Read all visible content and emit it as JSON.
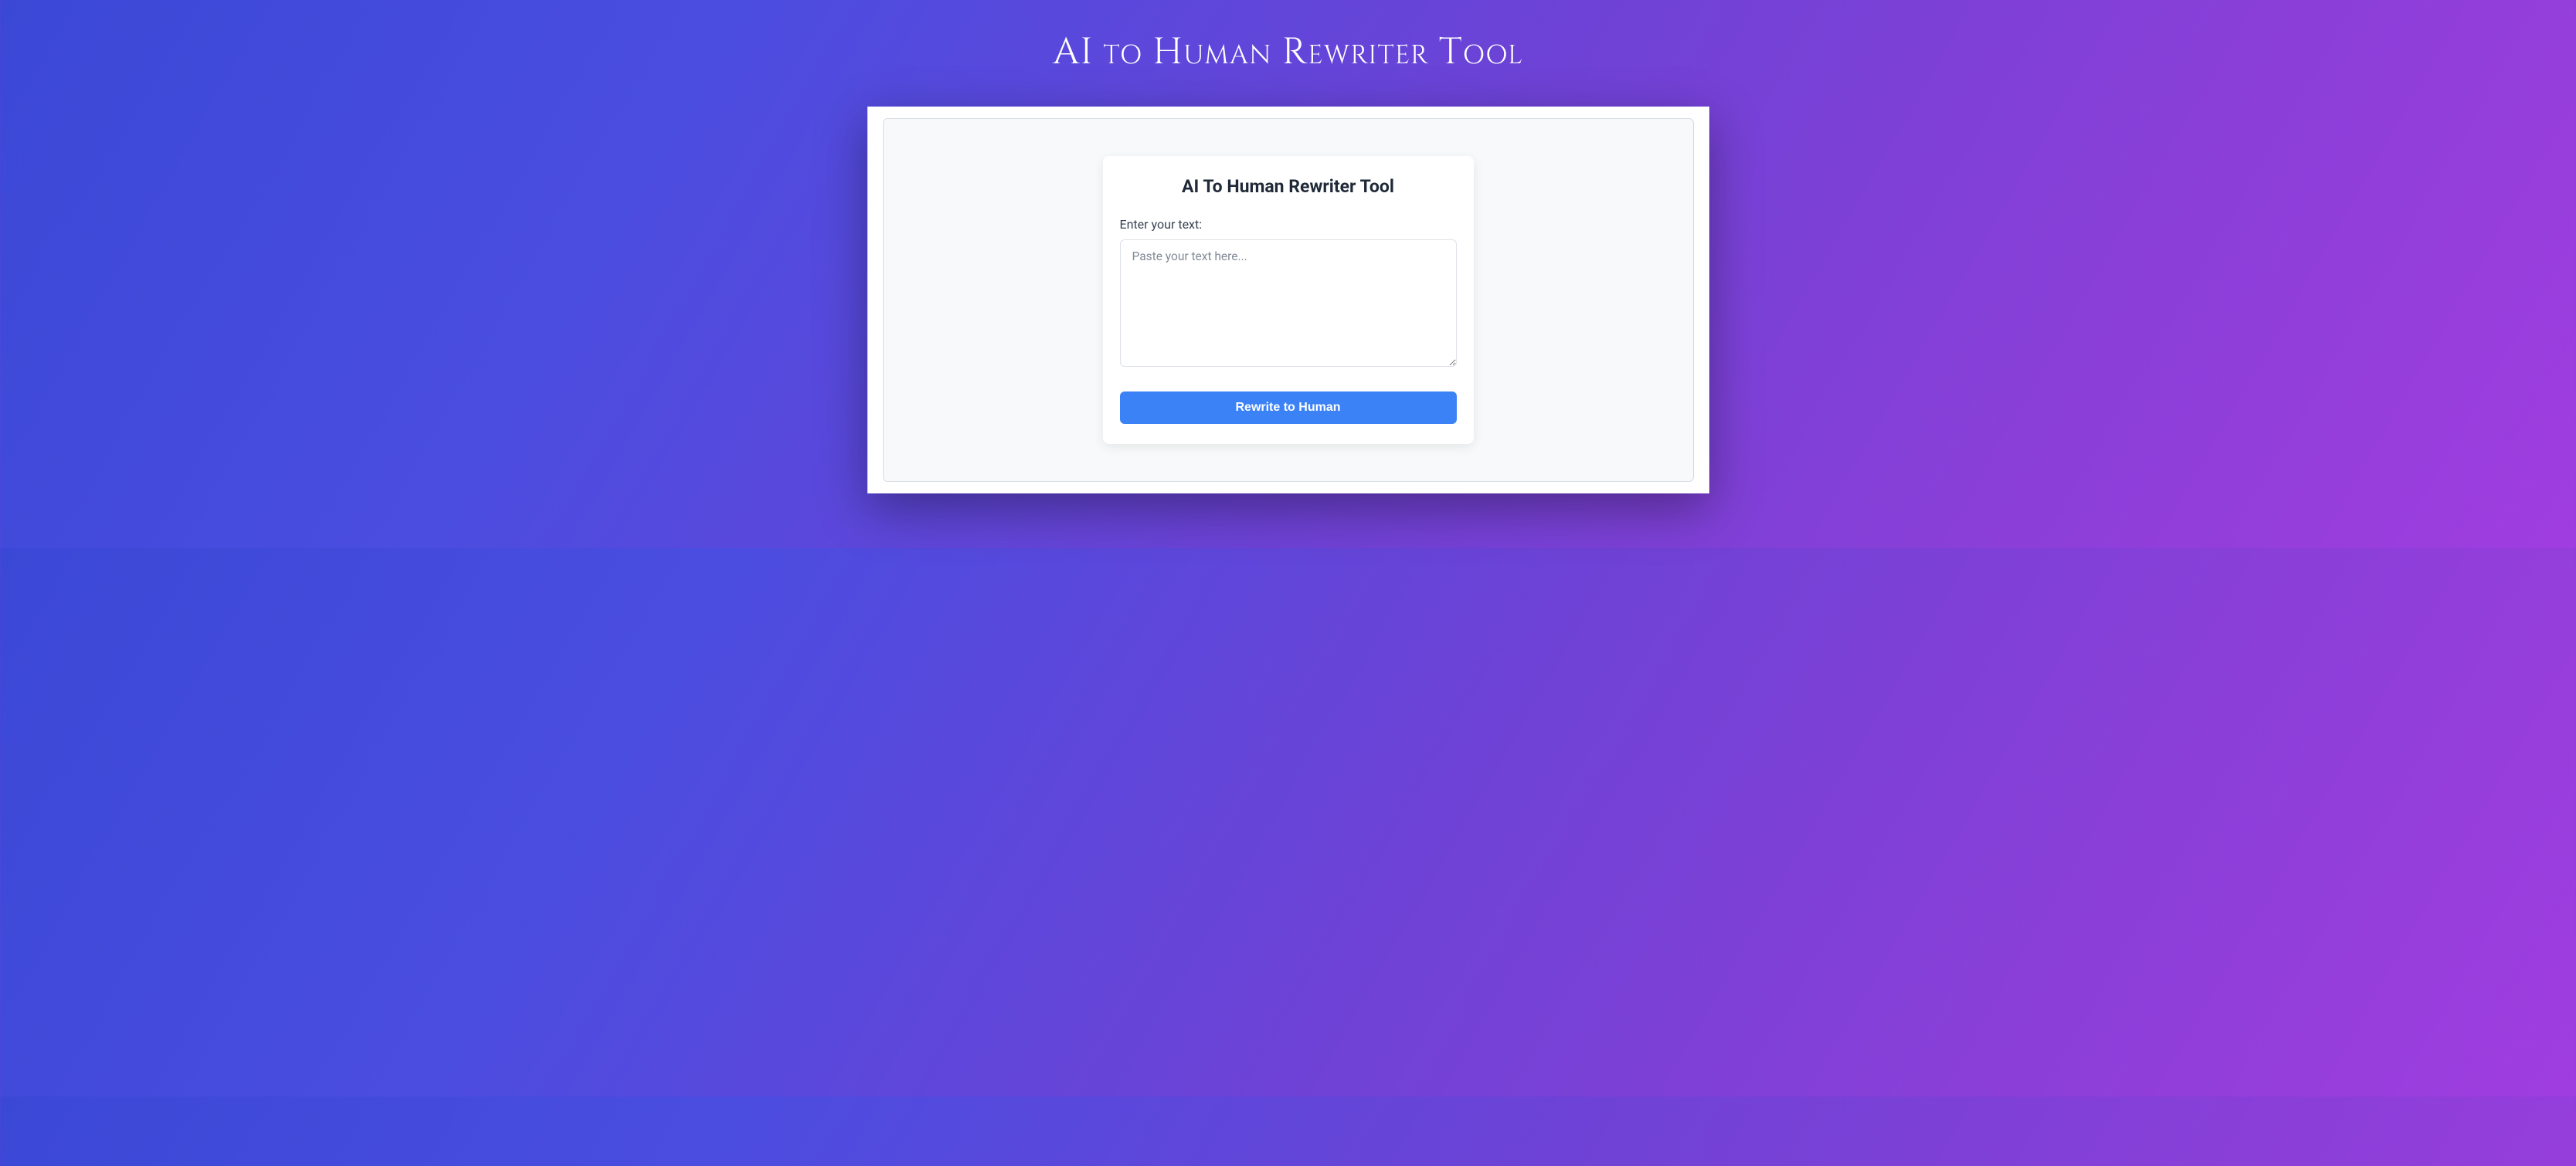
{
  "page": {
    "title": "AI to Human Rewriter Tool"
  },
  "card": {
    "title": "AI To Human Rewriter Tool",
    "input_label": "Enter your text:",
    "input_placeholder": "Paste your text here...",
    "input_value": "",
    "submit_label": "Rewrite to Human"
  }
}
